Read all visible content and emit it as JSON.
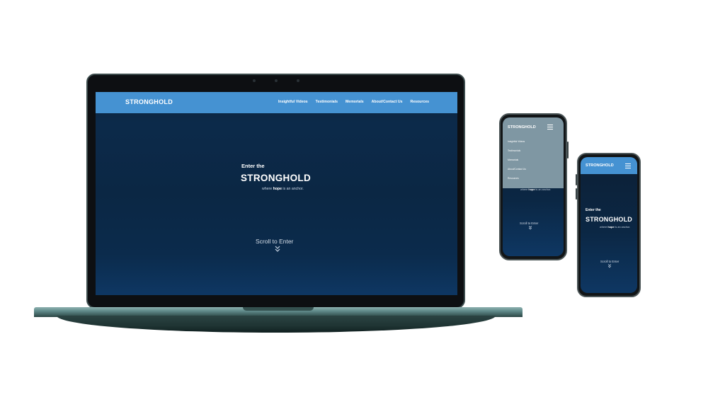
{
  "site": {
    "brand": "STRONGHOLD",
    "nav_links": [
      "Insightful Videos",
      "Testimonials",
      "Memorials",
      "About/Contact Us",
      "Resources"
    ],
    "hero": {
      "pre_title": "Enter the",
      "title": "STRONGHOLD",
      "tagline_before": "where ",
      "tagline_bold": "hope",
      "tagline_after": " is an anchor."
    },
    "scroll_cta": "Scroll to Enter"
  },
  "icons": {
    "scroll": "double-chevron-down-icon",
    "menu": "hamburger-menu-icon"
  },
  "colors": {
    "nav_bar": "#4592d2",
    "mobile_menu_overlay": "#7f97a3",
    "hero_background": "#0b2744",
    "device_frame": "#3d4d4e"
  }
}
